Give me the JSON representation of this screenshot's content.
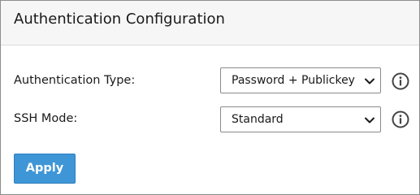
{
  "panel": {
    "title": "Authentication Configuration"
  },
  "fields": [
    {
      "label": "Authentication Type:",
      "selected": "Password + Publickey",
      "icon": "info-icon"
    },
    {
      "label": "SSH Mode:",
      "selected": "Standard",
      "icon": "info-icon"
    }
  ],
  "actions": {
    "apply_label": "Apply"
  },
  "colors": {
    "accent": "#3f96d6",
    "header_bg": "#f6f6f6",
    "border": "#8c8c8c"
  }
}
